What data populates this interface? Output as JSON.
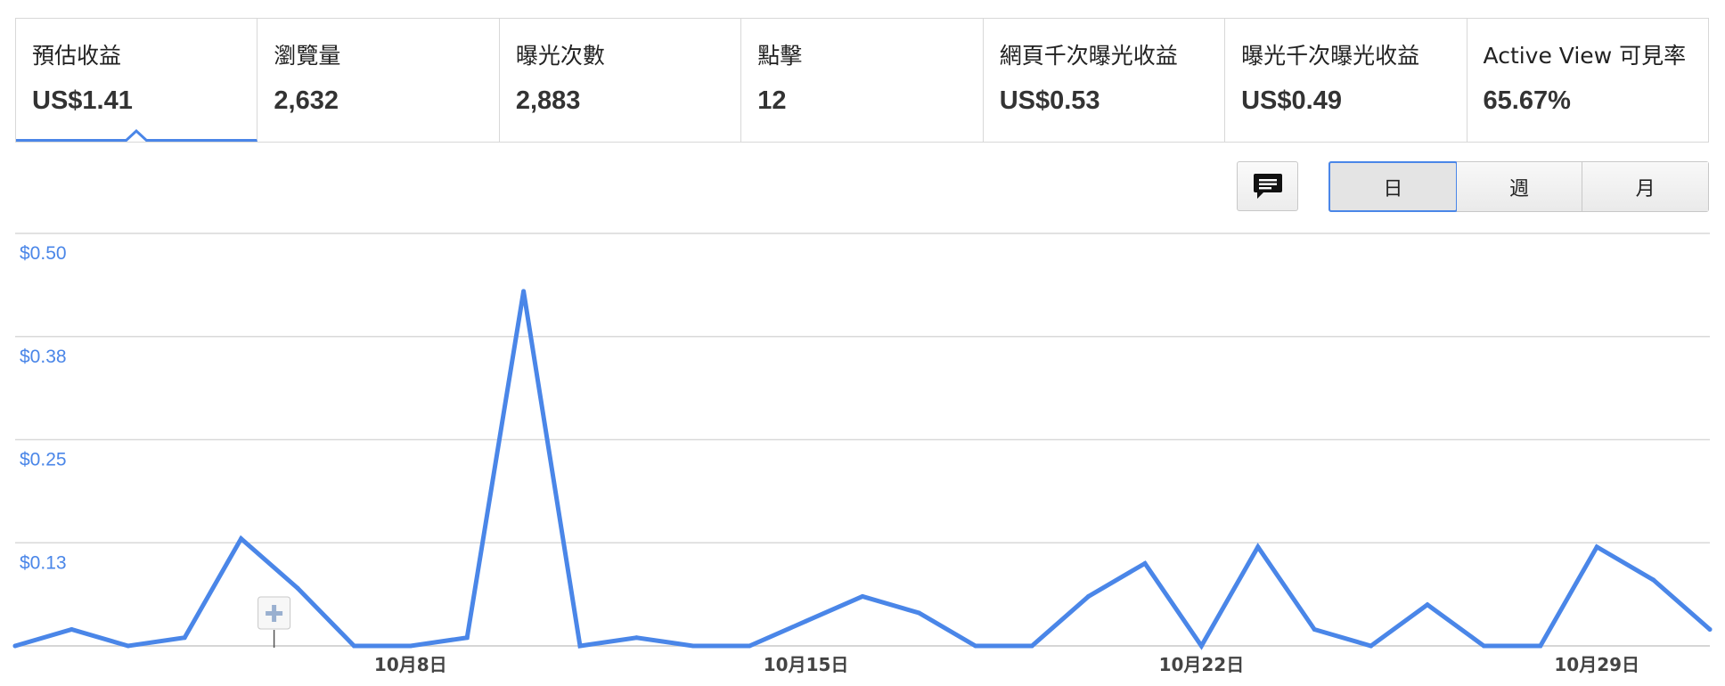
{
  "metrics": [
    {
      "label": "預估收益",
      "value": "US$1.41"
    },
    {
      "label": "瀏覽量",
      "value": "2,632"
    },
    {
      "label": "曝光次數",
      "value": "2,883"
    },
    {
      "label": "點擊",
      "value": "12"
    },
    {
      "label": "網頁千次曝光收益",
      "value": "US$0.53"
    },
    {
      "label": "曝光千次曝光收益",
      "value": "US$0.49"
    },
    {
      "label": "Active View 可見率",
      "value": "65.67%"
    }
  ],
  "selected_metric": "預估收益",
  "controls": {
    "comment_icon": "comment-icon",
    "granularity": [
      "日",
      "週",
      "月"
    ],
    "active_granularity": "日"
  },
  "colors": {
    "line": "#4a86e8",
    "axis_label": "#4a86e8",
    "grid": "#d9d9d9"
  },
  "chart_data": {
    "type": "line",
    "series": [
      {
        "values": [
          0.0,
          0.02,
          0.0,
          0.01,
          0.13,
          0.07,
          0.0,
          0.0,
          0.01,
          0.43,
          0.0,
          0.01,
          0.0,
          0.0,
          0.03,
          0.06,
          0.04,
          0.0,
          0.0,
          0.06,
          0.1,
          0.0,
          0.12,
          0.02,
          0.0,
          0.05,
          0.0,
          0.0,
          0.12,
          0.08,
          0.02
        ]
      }
    ],
    "x": [
      "10月1日",
      "10月2日",
      "10月3日",
      "10月4日",
      "10月5日",
      "10月6日",
      "10月7日",
      "10月8日",
      "10月9日",
      "10月10日",
      "10月11日",
      "10月12日",
      "10月13日",
      "10月14日",
      "10月15日",
      "10月16日",
      "10月17日",
      "10月18日",
      "10月19日",
      "10月20日",
      "10月21日",
      "10月22日",
      "10月23日",
      "10月24日",
      "10月25日",
      "10月26日",
      "10月27日",
      "10月28日",
      "10月29日",
      "10月30日",
      "10月31日"
    ],
    "x_tick_labels": [
      "10月8日",
      "10月15日",
      "10月22日",
      "10月29日"
    ],
    "y_tick_labels": [
      "$0.50",
      "$0.38",
      "$0.25",
      "$0.13"
    ],
    "y_ticks": [
      0.5,
      0.375,
      0.25,
      0.125
    ],
    "ylim": [
      0,
      0.5
    ],
    "grid": true,
    "annotation_marker_date": "10月5日"
  }
}
